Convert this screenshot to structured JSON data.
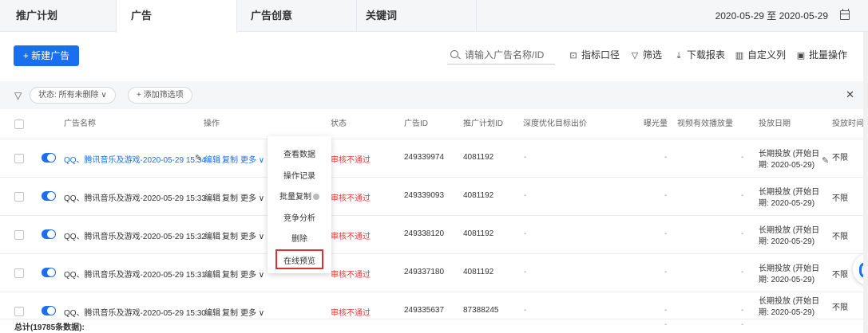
{
  "tabs": [
    "推广计划",
    "广告",
    "广告创意",
    "关键词"
  ],
  "date_range": "2020-05-29 至 2020-05-29",
  "toolbar": {
    "new_button": "+ 新建广告",
    "search_placeholder": "请输入广告名称/ID",
    "metric_caliber": "指标口径",
    "filter": "筛选",
    "download_report": "下载报表",
    "custom_columns": "自定义列",
    "batch_ops": "批量操作"
  },
  "filters": {
    "status_chip": "状态:  所有未删除 ∨",
    "add_filter": "+ 添加筛选项"
  },
  "columns": [
    "广告名称",
    "操作",
    "状态",
    "广告ID",
    "推广计划ID",
    "深度优化目标出价",
    "曝光量",
    "视频有效播放量",
    "投放日期",
    "投放时间"
  ],
  "row_actions": {
    "edit": "编辑",
    "copy": "复制",
    "more": "更多 ∨"
  },
  "rows": [
    {
      "name": "QQ、腾讯音乐及游戏-2020-05-29 15:34",
      "status": "审核不通过",
      "ad_id": "249339974",
      "plan_id": "4081192",
      "bid": "-",
      "impressions": "-",
      "video_plays": "-",
      "date_line1": "长期投放 (开始日",
      "date_line2": "期: 2020-05-29)",
      "time": "不限"
    },
    {
      "name": "QQ、腾讯音乐及游戏-2020-05-29 15:33",
      "status": "审核不通过",
      "ad_id": "249339093",
      "plan_id": "4081192",
      "bid": "-",
      "impressions": "-",
      "video_plays": "-",
      "date_line1": "长期投放 (开始日",
      "date_line2": "期: 2020-05-29)",
      "time": "不限"
    },
    {
      "name": "QQ、腾讯音乐及游戏-2020-05-29 15:32",
      "status": "审核不通过",
      "ad_id": "249338120",
      "plan_id": "4081192",
      "bid": "-",
      "impressions": "-",
      "video_plays": "-",
      "date_line1": "长期投放 (开始日",
      "date_line2": "期: 2020-05-29)",
      "time": "不限"
    },
    {
      "name": "QQ、腾讯音乐及游戏-2020-05-29 15:31",
      "status": "审核不通过",
      "ad_id": "249337180",
      "plan_id": "4081192",
      "bid": "-",
      "impressions": "-",
      "video_plays": "-",
      "date_line1": "长期投放 (开始日",
      "date_line2": "期: 2020-05-29)",
      "time": "不限"
    },
    {
      "name": "QQ、腾讯音乐及游戏-2020-05-29 15:30",
      "status": "审核不通过",
      "ad_id": "249335637",
      "plan_id": "87388245",
      "bid": "-",
      "impressions": "-",
      "video_plays": "-",
      "date_line1": "长期投放 (开始日",
      "date_line2": "期: 2020-05-29)",
      "time": "不限"
    }
  ],
  "dropdown": [
    "查看数据",
    "操作记录",
    "批量复制",
    "竞争分析",
    "删除",
    "在线预览"
  ],
  "total": {
    "label": "总计(19785条数据):",
    "impressions": "-",
    "video_plays": "-"
  },
  "colors": {
    "accent": "#1a6ff0",
    "error": "#e03a3a",
    "highlight": "#e02f2f"
  },
  "icons": [
    "search-icon",
    "calendar-icon",
    "funnel-icon",
    "close-icon",
    "edit-icon",
    "download-icon",
    "columns-icon",
    "batch-icon",
    "help-icon"
  ]
}
